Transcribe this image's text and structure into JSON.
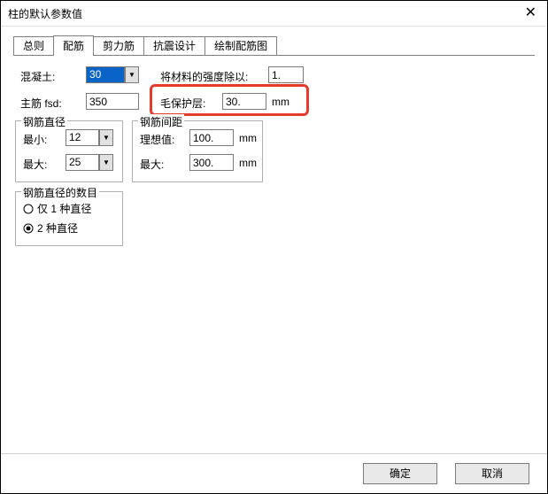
{
  "window": {
    "title": "柱的默认参数值"
  },
  "tabs": [
    "总则",
    "配筋",
    "剪力筋",
    "抗震设计",
    "绘制配筋图"
  ],
  "active_tab_index": 1,
  "row1": {
    "concrete_label": "混凝土:",
    "concrete_value": "30",
    "divide_label": "将材料的强度除以:",
    "divide_value": "1."
  },
  "row2": {
    "mainbar_label": "主筋 fsd:",
    "mainbar_value": "350",
    "cover_label": "毛保护层:",
    "cover_value": "30.",
    "cover_unit": "mm"
  },
  "diam_group": {
    "title": "钢筋直径",
    "min_label": "最小:",
    "min_value": "12",
    "max_label": "最大:",
    "max_value": "25"
  },
  "spacing_group": {
    "title": "钢筋间距",
    "ideal_label": "理想值:",
    "ideal_value": "100.",
    "ideal_unit": "mm",
    "max_label": "最大:",
    "max_value": "300.",
    "max_unit": "mm"
  },
  "count_group": {
    "title": "钢筋直径的数目",
    "opt1": "仅 1 种直径",
    "opt2": "2 种直径",
    "selected": 1
  },
  "footer": {
    "ok": "确定",
    "cancel": "取消"
  }
}
